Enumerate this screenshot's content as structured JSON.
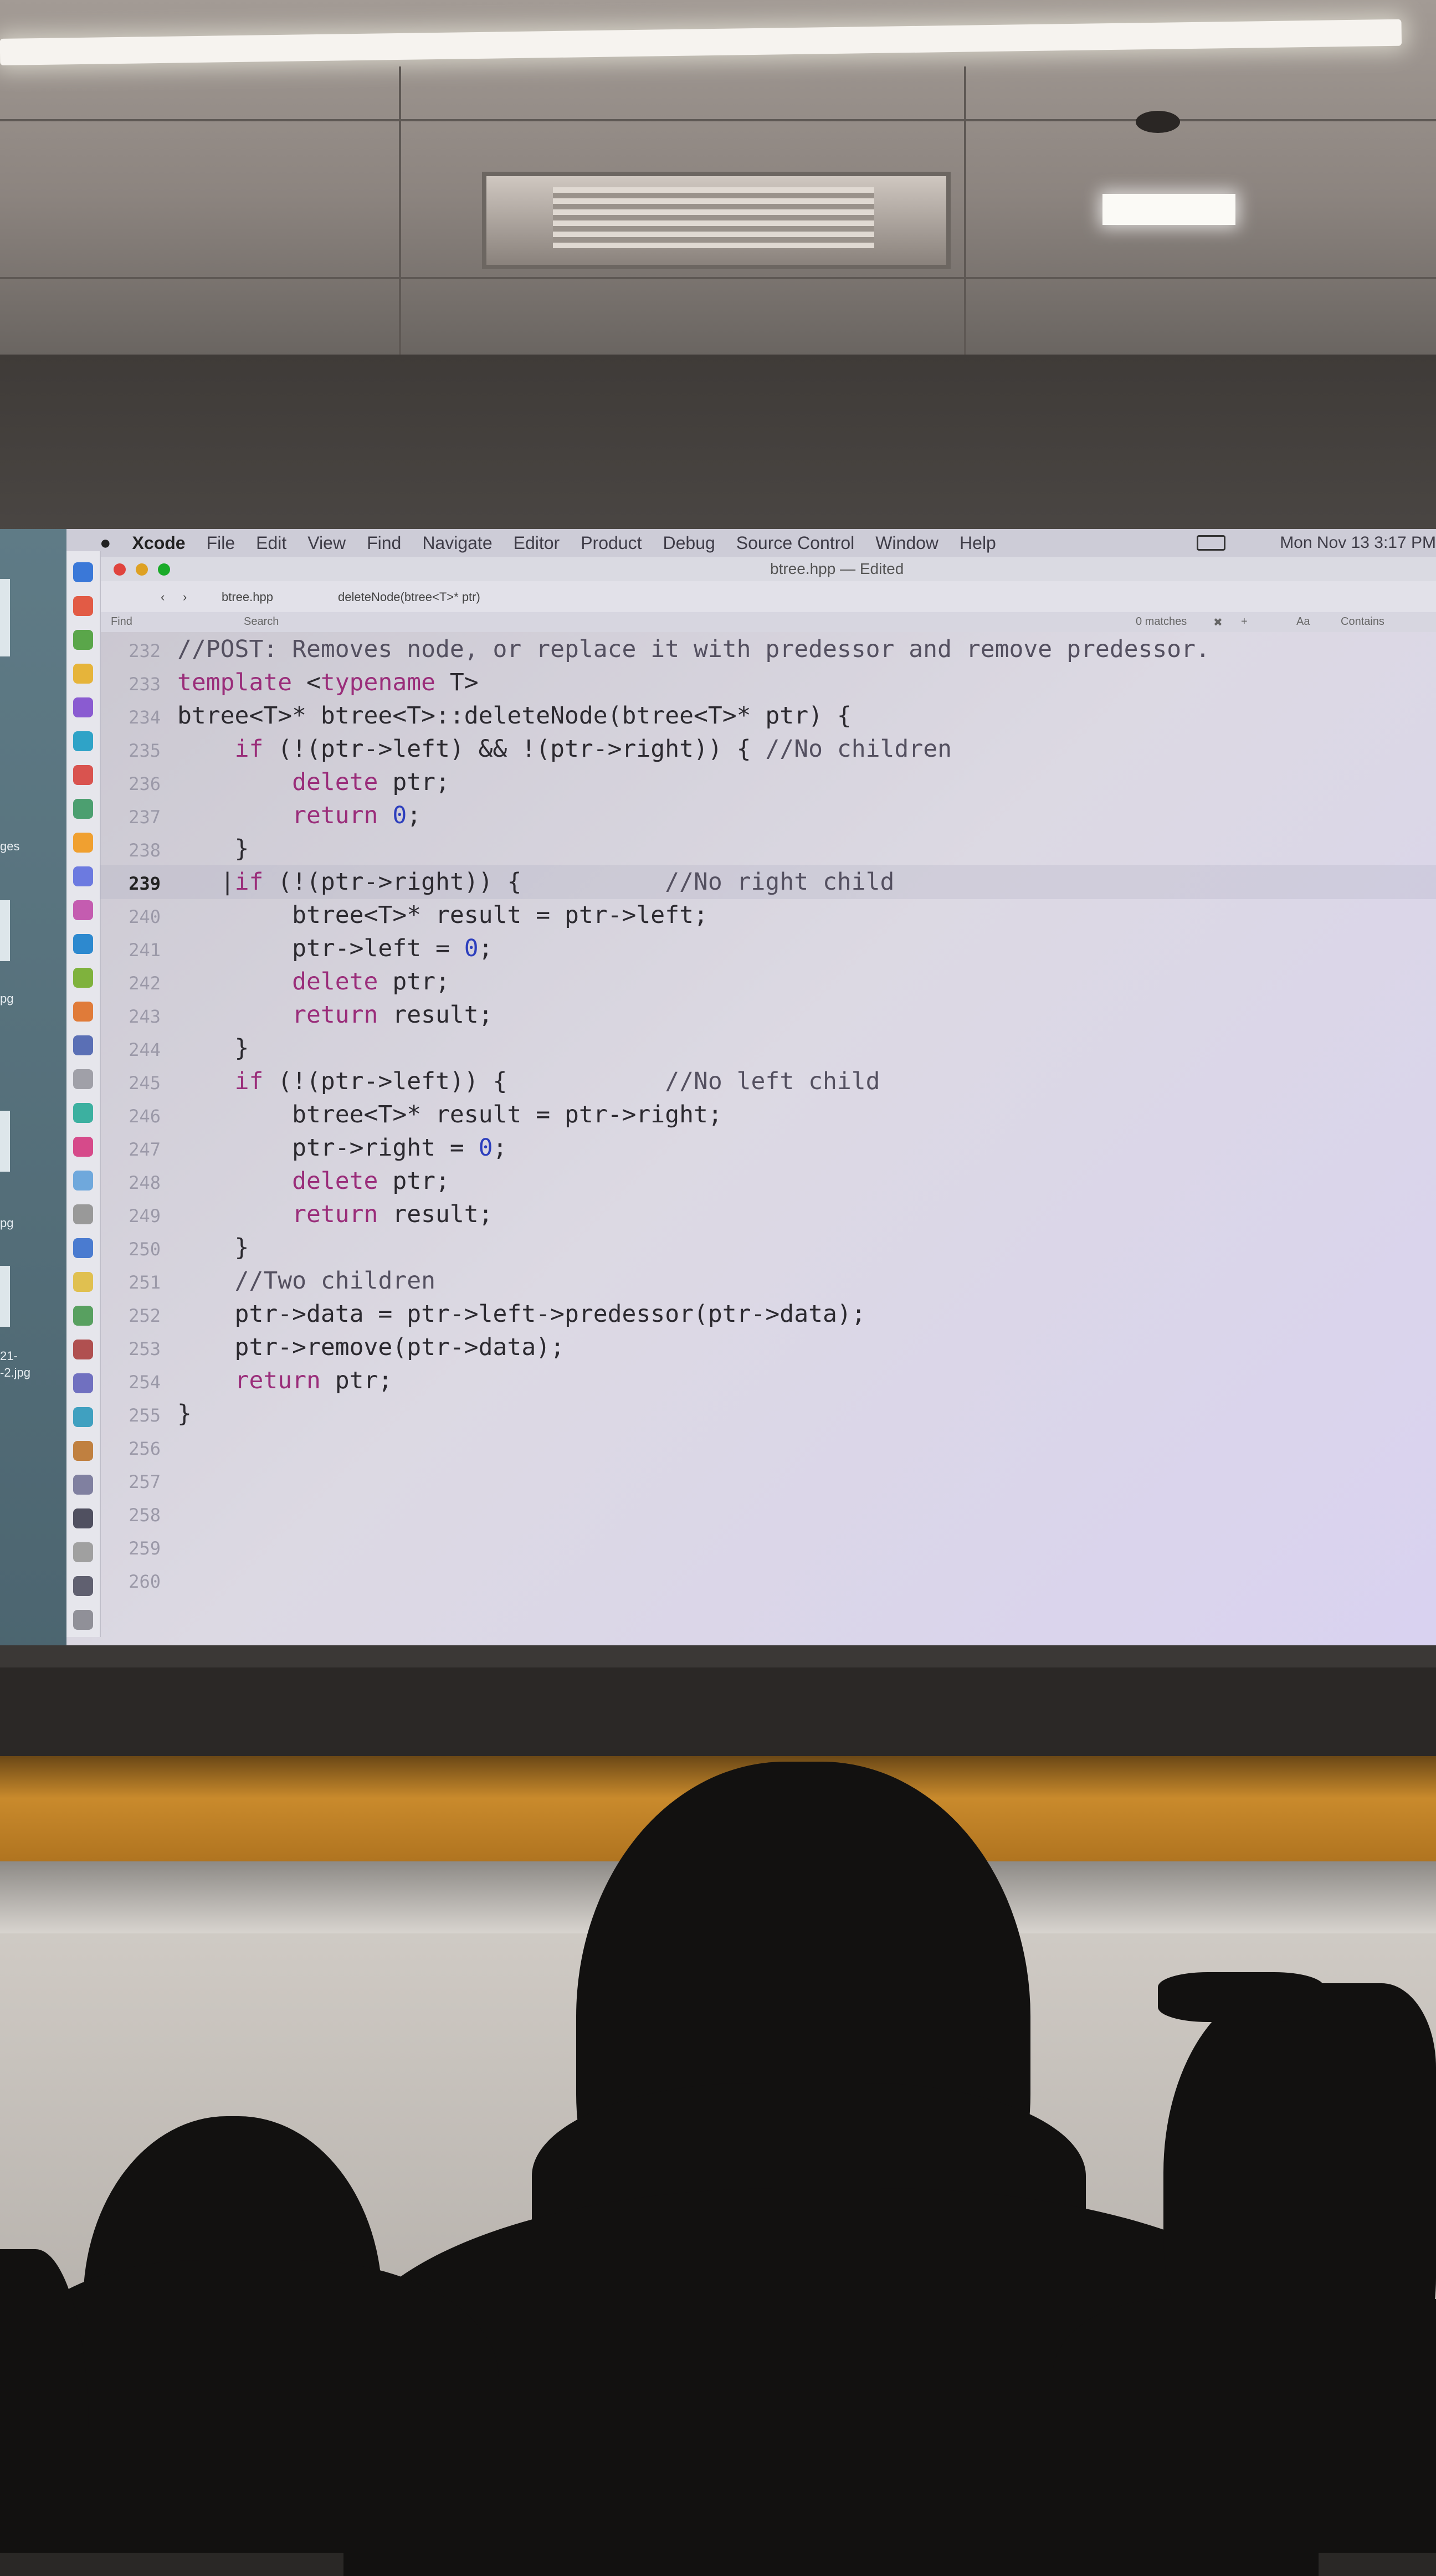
{
  "menubar": {
    "apple_icon": "apple-logo-icon",
    "app_name": "Xcode",
    "items": [
      "File",
      "Edit",
      "View",
      "Find",
      "Navigate",
      "Editor",
      "Product",
      "Debug",
      "Source Control",
      "Window",
      "Help"
    ],
    "clock": "Mon Nov 13  3:17 PM"
  },
  "window": {
    "title": "btree.hpp — Edited",
    "traffic_colors": [
      "#e0443e",
      "#dea123",
      "#1aab29"
    ]
  },
  "jumpbar": {
    "file": "btree.hpp",
    "symbol": "deleteNode(btree<T>* ptr)"
  },
  "findbar": {
    "find_label": "Find",
    "search_placeholder": "Search",
    "match_count": "0 matches",
    "aa_label": "Aa",
    "contains_label": "Contains"
  },
  "left_pane": {
    "labels": [
      "ges",
      "pg",
      "pg",
      "21-",
      "-2.jpg"
    ]
  },
  "code": {
    "current_line": 239,
    "lines": [
      {
        "n": "232",
        "text": "//POST: Removes node, or replace it with predessor and remove predessor."
      },
      {
        "n": "233",
        "text": "template <typename T>"
      },
      {
        "n": "234",
        "text": "btree<T>* btree<T>::deleteNode(btree<T>* ptr) {"
      },
      {
        "n": "235",
        "text": "    if (!(ptr->left) && !(ptr->right)) { //No children"
      },
      {
        "n": "236",
        "text": "        delete ptr;"
      },
      {
        "n": "237",
        "text": "        return 0;"
      },
      {
        "n": "238",
        "text": "    }"
      },
      {
        "n": "239",
        "text": "   |if (!(ptr->right)) {          //No right child"
      },
      {
        "n": "240",
        "text": "        btree<T>* result = ptr->left;"
      },
      {
        "n": "241",
        "text": "        ptr->left = 0;"
      },
      {
        "n": "242",
        "text": "        delete ptr;"
      },
      {
        "n": "243",
        "text": "        return result;"
      },
      {
        "n": "244",
        "text": "    }"
      },
      {
        "n": "245",
        "text": "    if (!(ptr->left)) {           //No left child"
      },
      {
        "n": "246",
        "text": "        btree<T>* result = ptr->right;"
      },
      {
        "n": "247",
        "text": "        ptr->right = 0;"
      },
      {
        "n": "248",
        "text": "        delete ptr;"
      },
      {
        "n": "249",
        "text": "        return result;"
      },
      {
        "n": "250",
        "text": "    }"
      },
      {
        "n": "251",
        "text": "    //Two children"
      },
      {
        "n": "252",
        "text": "    ptr->data = ptr->left->predessor(ptr->data);"
      },
      {
        "n": "253",
        "text": "    ptr->remove(ptr->data);"
      },
      {
        "n": "254",
        "text": "    return ptr;"
      },
      {
        "n": "255",
        "text": "}"
      },
      {
        "n": "256",
        "text": ""
      },
      {
        "n": "257",
        "text": ""
      },
      {
        "n": "258",
        "text": ""
      },
      {
        "n": "259",
        "text": ""
      },
      {
        "n": "260",
        "text": ""
      }
    ]
  },
  "dock_icon_colors": [
    "#3a78d8",
    "#e25b45",
    "#5aa64a",
    "#e6b43a",
    "#8a5bd1",
    "#2fa3c7",
    "#d9534f",
    "#4c9f70",
    "#f0a030",
    "#6c7ae0",
    "#c45cb0",
    "#2d89cf",
    "#7fb23d",
    "#e07b39",
    "#5a6fb5",
    "#a0a0a8",
    "#3cb0a0",
    "#d64a8a",
    "#6fa8dc",
    "#999999",
    "#4a7bd0",
    "#e0c050",
    "#58a060",
    "#b05050",
    "#7070c0",
    "#40a0c0",
    "#c08040",
    "#8080a0",
    "#505060",
    "#a0a0a0",
    "#606070",
    "#909098"
  ]
}
